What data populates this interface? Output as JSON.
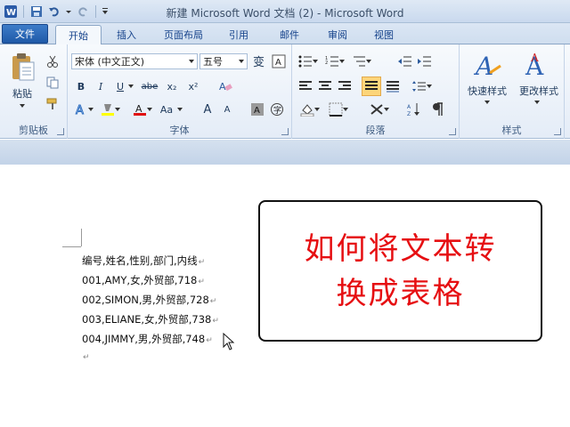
{
  "window": {
    "title": "新建 Microsoft Word 文档 (2) - Microsoft Word"
  },
  "tabs": [
    "文件",
    "开始",
    "插入",
    "页面布局",
    "引用",
    "邮件",
    "审阅",
    "视图"
  ],
  "ribbon": {
    "clipboard": {
      "paste": "粘贴",
      "group_label": "剪贴板"
    },
    "font": {
      "font_name": "宋体 (中文正文)",
      "font_size": "五号",
      "bold": "B",
      "italic": "I",
      "underline": "U",
      "strike": "abe",
      "subscript": "x₂",
      "superscript": "x²",
      "change_case": "Aa",
      "grow": "A",
      "shrink": "A",
      "group_label": "字体"
    },
    "paragraph": {
      "group_label": "段落"
    },
    "styles": {
      "quick_styles": "快速样式",
      "change_styles": "更改样式",
      "group_label": "样式"
    }
  },
  "document": {
    "lines": [
      "编号,姓名,性别,部门,内线",
      "001,AMY,女,外贸部,718",
      "002,SIMON,男,外贸部,728",
      "003,ELIANE,女,外贸部,738",
      "004,JIMMY,男,外贸部,748"
    ],
    "paragraph_mark": "↵"
  },
  "callout": {
    "line1": "如何将文本转",
    "line2": "换成表格"
  },
  "colors": {
    "callout_text": "#e60f12",
    "file_tab": "#2a66b5"
  }
}
